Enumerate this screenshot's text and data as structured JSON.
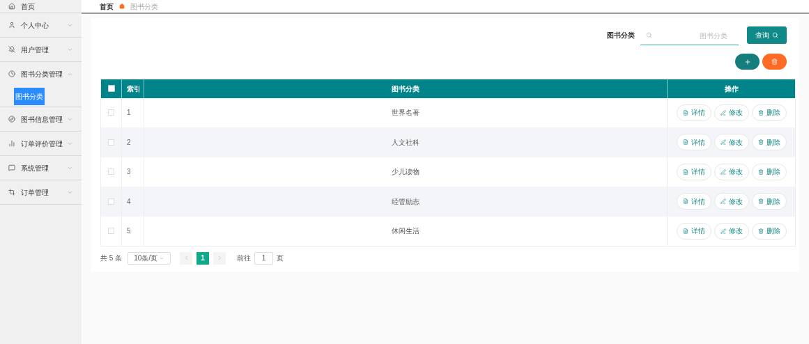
{
  "sidebar": {
    "items": [
      {
        "label": "首页",
        "kind": "link"
      },
      {
        "label": "个人中心",
        "kind": "menu",
        "expanded": false
      },
      {
        "label": "用户管理",
        "kind": "menu",
        "expanded": false
      },
      {
        "label": "图书分类管理",
        "kind": "menu",
        "expanded": true,
        "children": [
          {
            "label": "图书分类",
            "selected": true
          }
        ]
      },
      {
        "label": "图书信息管理",
        "kind": "menu",
        "expanded": false
      },
      {
        "label": "订单评价管理",
        "kind": "menu",
        "expanded": false
      },
      {
        "label": "系统管理",
        "kind": "menu",
        "expanded": false
      },
      {
        "label": "订单管理",
        "kind": "menu",
        "expanded": false
      }
    ]
  },
  "breadcrumb": [
    "首页",
    "图书分类"
  ],
  "search": {
    "label": "图书分类",
    "placeholder": "图书分类",
    "button": "查询"
  },
  "table": {
    "select_all_checked": false,
    "columns": [
      "索引",
      "图书分类",
      "操作"
    ],
    "rows": [
      {
        "checked": false,
        "index": "1",
        "name": "世界名著",
        "actions": [
          "详情",
          "修改",
          "删除"
        ]
      },
      {
        "checked": false,
        "index": "2",
        "name": "人文社科",
        "actions": [
          "详情",
          "修改",
          "删除"
        ]
      },
      {
        "checked": false,
        "index": "3",
        "name": "少儿读物",
        "actions": [
          "详情",
          "修改",
          "删除"
        ]
      },
      {
        "checked": false,
        "index": "4",
        "name": "经管励志",
        "actions": [
          "详情",
          "修改",
          "删除"
        ]
      },
      {
        "checked": false,
        "index": "5",
        "name": "休闲生活",
        "actions": [
          "详情",
          "修改",
          "删除"
        ]
      }
    ]
  },
  "pagination": {
    "total": "共 5 条",
    "page_size": "10条/页",
    "pages": [
      {
        "label": "1",
        "selected": true
      }
    ],
    "goto_label": "前往",
    "goto_value": "1",
    "goto_suffix": "页"
  }
}
